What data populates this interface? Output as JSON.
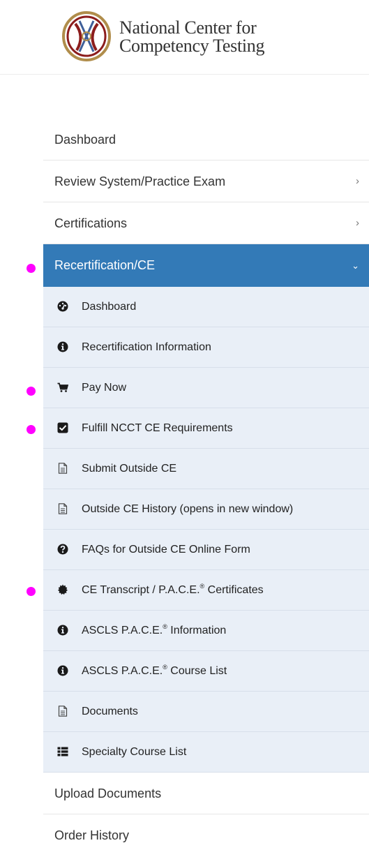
{
  "brand": {
    "name_line1": "National Center for",
    "name_line2": "Competency Testing"
  },
  "nav": {
    "items": [
      {
        "label": "Dashboard"
      },
      {
        "label": "Review System/Practice Exam",
        "chevron": "chevron-right-icon"
      },
      {
        "label": "Certifications",
        "chevron": "chevron-right-icon"
      },
      {
        "label": "Recertification/CE",
        "chevron": "chevron-down-icon",
        "active": true
      }
    ],
    "subitems": [
      {
        "label": "Dashboard",
        "icon": "tachometer-icon"
      },
      {
        "label": "Recertification Information",
        "icon": "info-circle-icon"
      },
      {
        "label": "Pay Now",
        "icon": "shopping-cart-icon"
      },
      {
        "label": "Fulfill NCCT CE Requirements",
        "icon": "check-square-icon"
      },
      {
        "label": "Submit Outside CE",
        "icon": "file-text-icon"
      },
      {
        "label": "Outside CE History (opens in new window)",
        "icon": "file-text-icon"
      },
      {
        "label": "FAQs for Outside CE Online Form",
        "icon": "question-circle-icon"
      },
      {
        "label_pre": "CE Transcript / P.A.C.E.",
        "mark": "®",
        "label_post": " Certificates",
        "icon": "certificate-icon"
      },
      {
        "label_pre": "ASCLS P.A.C.E.",
        "mark": "®",
        "label_post": " Information",
        "icon": "info-circle-icon"
      },
      {
        "label_pre": "ASCLS P.A.C.E.",
        "mark": "®",
        "label_post": " Course List",
        "icon": "info-circle-icon"
      },
      {
        "label": "Documents",
        "icon": "file-text-icon"
      },
      {
        "label": "Specialty Course List",
        "icon": "list-icon"
      }
    ],
    "after_items": [
      {
        "label": "Upload Documents"
      },
      {
        "label": "Order History"
      }
    ]
  },
  "colors": {
    "active_bg": "#337ab7",
    "submenu_bg": "#e9eff7",
    "marker": "#ff00ff"
  }
}
